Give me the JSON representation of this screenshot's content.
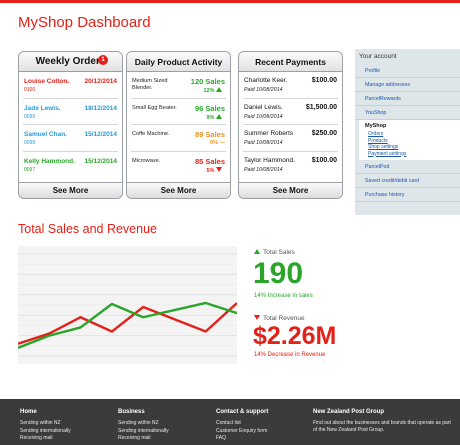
{
  "header": {
    "title": "MyShop Dashboard"
  },
  "weekly_orders": {
    "title": "Weekly Orders",
    "badge": "1",
    "rows": [
      {
        "name": "Louise Colton.",
        "date": "20/12/2014",
        "id": "0100",
        "color": "red"
      },
      {
        "name": "Jade Lewis.",
        "date": "18/12/2014",
        "id": "0099",
        "color": "blue"
      },
      {
        "name": "Samuel Chan.",
        "date": "15/12/2014",
        "id": "0098",
        "color": "blue"
      },
      {
        "name": "Kelly Hammond.",
        "date": "15/12/2014",
        "id": "0097",
        "color": "green"
      }
    ],
    "see_more": "See More"
  },
  "product_activity": {
    "title": "Daily Product Activity",
    "rows": [
      {
        "product": "Medium Sized Blender.",
        "sales": "120 Sales",
        "pct": "12%",
        "trend": "up",
        "color": "green"
      },
      {
        "product": "Small Egg Beater.",
        "sales": "96 Sales",
        "pct": "9%",
        "trend": "up",
        "color": "green"
      },
      {
        "product": "Coffe Machine.",
        "sales": "89 Sales",
        "pct": "0%",
        "trend": "flat",
        "color": "orange"
      },
      {
        "product": "Microwave.",
        "sales": "85 Sales",
        "pct": "5%",
        "trend": "down",
        "color": "red"
      }
    ],
    "see_more": "See More"
  },
  "recent_payments": {
    "title": "Recent Payments",
    "rows": [
      {
        "name": "Charlotte Keer.",
        "amount": "$100.00",
        "paid": "Paid 10/08/2014"
      },
      {
        "name": "Daniel Lewis.",
        "amount": "$1,500.00",
        "paid": "Paid 10/08/2014"
      },
      {
        "name": "Summer Roberts",
        "amount": "$250.00",
        "paid": "Paid 10/08/2014"
      },
      {
        "name": "Taylor Hammond.",
        "amount": "$100.00",
        "paid": "Paid 10/08/2014"
      }
    ],
    "see_more": "See More"
  },
  "sidebar": {
    "title": "Your account",
    "items_top": [
      "Profile",
      "Manage addresses",
      "ParcelRewards",
      "YouShop"
    ],
    "myshop": {
      "title": "MyShop",
      "links": [
        "Orders",
        "Products",
        "Shop settings",
        "Payment settings"
      ]
    },
    "items_bottom": [
      "ParcelPod",
      "Saved credit/debit card",
      "Purchase history"
    ]
  },
  "sales_section": {
    "title": "Total Sales and Revenue",
    "sales_label": "Total Sales",
    "sales_value": "190",
    "sales_change": "14% Increase in sales",
    "revenue_label": "Total Revenue",
    "revenue_value": "$2.26M",
    "revenue_change": "14% Decrease in Revenue"
  },
  "chart_data": {
    "type": "line",
    "title": "",
    "xlabel": "",
    "ylabel": "",
    "grid": true,
    "x": [
      0,
      1,
      2,
      3,
      4,
      5,
      6,
      7
    ],
    "ylim": [
      0,
      10
    ],
    "series": [
      {
        "color": "#e32119",
        "values": [
          1.2,
          2.2,
          3.8,
          2.4,
          4.8,
          3.6,
          2.4,
          5.2
        ]
      },
      {
        "color": "#2aa52a",
        "values": [
          0.8,
          2.0,
          2.8,
          5.1,
          3.8,
          4.5,
          5.2,
          4.2
        ]
      }
    ]
  },
  "footer": {
    "col1": {
      "title": "Home",
      "links": [
        "Sending within NZ",
        "Sending internationally",
        "Receiving mail"
      ]
    },
    "col2": {
      "title": "Business",
      "links": [
        "Sending within NZ",
        "Sending internationally",
        "Receiving mail"
      ]
    },
    "col3": {
      "title": "Contact & support",
      "links": [
        "Contact list",
        "Customer Enquiry form",
        "FAQ"
      ]
    },
    "col4": {
      "title": "New Zealand Post Group",
      "text": "Find out about the businesses and brands that operate as part of the New Zealand Post Group."
    }
  },
  "colors": {
    "accent": "#e32119",
    "blue": "#2a9bd8",
    "green": "#2aa52a",
    "orange": "#e8931e",
    "footer": "#3b3b3b"
  }
}
